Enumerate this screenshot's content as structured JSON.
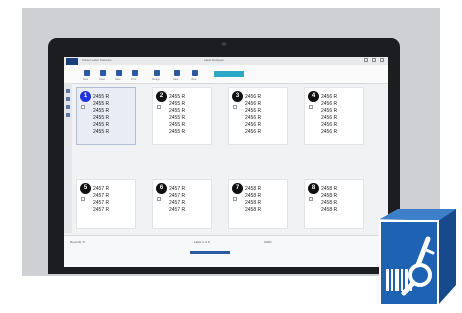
{
  "window": {
    "title": "Printer Label Software",
    "center_title": "Label Designer"
  },
  "toolbar": {
    "items": [
      "New",
      "Open",
      "Save",
      "Print",
      "Design",
      "Data",
      "View"
    ]
  },
  "labels": [
    {
      "number": "1",
      "selected": true,
      "lines": [
        "2455 R",
        "2455 R",
        "2455 R",
        "2455 R",
        "2455 R",
        "2455 R"
      ]
    },
    {
      "number": "2",
      "selected": false,
      "lines": [
        "2455 R",
        "2455 R",
        "2455 R",
        "2455 R",
        "2455 R",
        "2455 R"
      ]
    },
    {
      "number": "3",
      "selected": false,
      "lines": [
        "2456 R",
        "2456 R",
        "2456 R",
        "2456 R",
        "2456 R",
        "2456 R"
      ]
    },
    {
      "number": "4",
      "selected": false,
      "lines": [
        "2456 R",
        "2456 R",
        "2456 R",
        "2456 R",
        "2456 R",
        "2456 R"
      ]
    },
    {
      "number": "5",
      "selected": false,
      "lines": [
        "2457 R",
        "2457 R",
        "2457 R",
        "2457 R"
      ]
    },
    {
      "number": "6",
      "selected": false,
      "lines": [
        "2457 R",
        "2457 R",
        "2457 R",
        "2457 R"
      ]
    },
    {
      "number": "7",
      "selected": false,
      "lines": [
        "2458 R",
        "2458 R",
        "2458 R",
        "2458 R"
      ]
    },
    {
      "number": "8",
      "selected": false,
      "lines": [
        "2458 R",
        "2458 R",
        "2458 R",
        "2458 R"
      ]
    }
  ],
  "statusbar": {
    "left": "Records: 8",
    "center": "Label 1 of 8",
    "right": "100%"
  },
  "colors": {
    "accent": "#2c5aa0",
    "selected_dot": "#2233dd",
    "icon_blue": "#1e62b4"
  },
  "icons": [
    "app-badge-icon",
    "barcode-scanner-magnifier-icon"
  ]
}
